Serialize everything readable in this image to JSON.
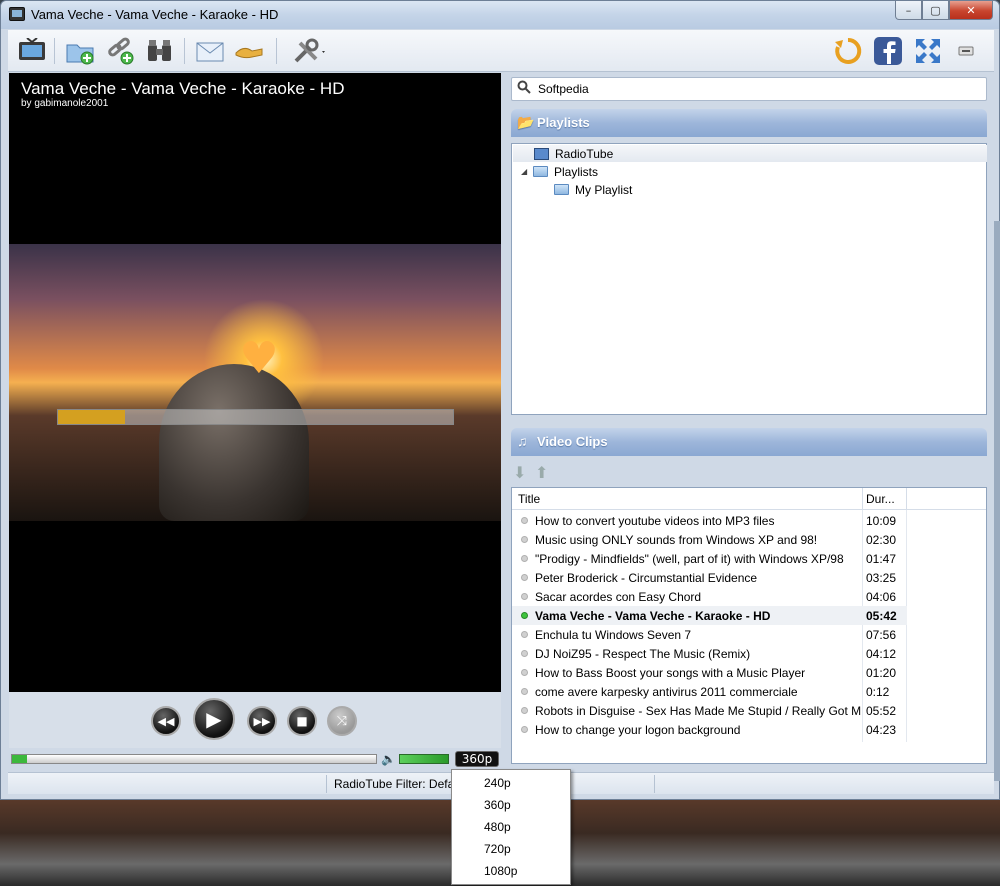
{
  "window": {
    "title": "Vama Veche - Vama Veche - Karaoke - HD"
  },
  "video": {
    "title": "Vama Veche - Vama Veche - Karaoke - HD",
    "author": "by gabimanole2001",
    "buffer_percent": 17
  },
  "playback": {
    "progress_percent": 4,
    "quality_label": "360p"
  },
  "search": {
    "value": "Softpedia"
  },
  "playlists": {
    "header": "Playlists",
    "items": [
      {
        "label": "RadioTube"
      },
      {
        "label": "Playlists"
      },
      {
        "label": "My Playlist"
      }
    ]
  },
  "clips": {
    "header": "Video Clips",
    "columns": {
      "title": "Title",
      "duration": "Dur..."
    },
    "rows": [
      {
        "title": "How to convert youtube videos into MP3 files",
        "duration": "10:09"
      },
      {
        "title": "Music using ONLY sounds from Windows XP and 98!",
        "duration": "02:30"
      },
      {
        "title": "\"Prodigy - Mindfields\" (well, part of it) with Windows XP/98",
        "duration": "01:47"
      },
      {
        "title": "Peter Broderick - Circumstantial Evidence",
        "duration": "03:25"
      },
      {
        "title": "Sacar acordes con Easy Chord",
        "duration": "04:06"
      },
      {
        "title": "Vama Veche - Vama Veche - Karaoke - HD",
        "duration": "05:42"
      },
      {
        "title": "Enchula tu Windows Seven 7",
        "duration": "07:56"
      },
      {
        "title": "DJ NoiZ95 - Respect The Music (Remix)",
        "duration": "04:12"
      },
      {
        "title": "How to Bass Boost your songs with a Music Player",
        "duration": "01:20"
      },
      {
        "title": "come avere karpesky antivirus 2011 commerciale",
        "duration": "0:12"
      },
      {
        "title": "Robots in Disguise - Sex Has Made Me Stupid / Really Got Me",
        "duration": "05:52"
      },
      {
        "title": "How to change your logon background",
        "duration": "04:23"
      }
    ]
  },
  "status": {
    "filter_text": "RadioTube Filter: Defa"
  },
  "quality_menu": {
    "options": [
      "240p",
      "360p",
      "480p",
      "720p",
      "1080p"
    ]
  }
}
